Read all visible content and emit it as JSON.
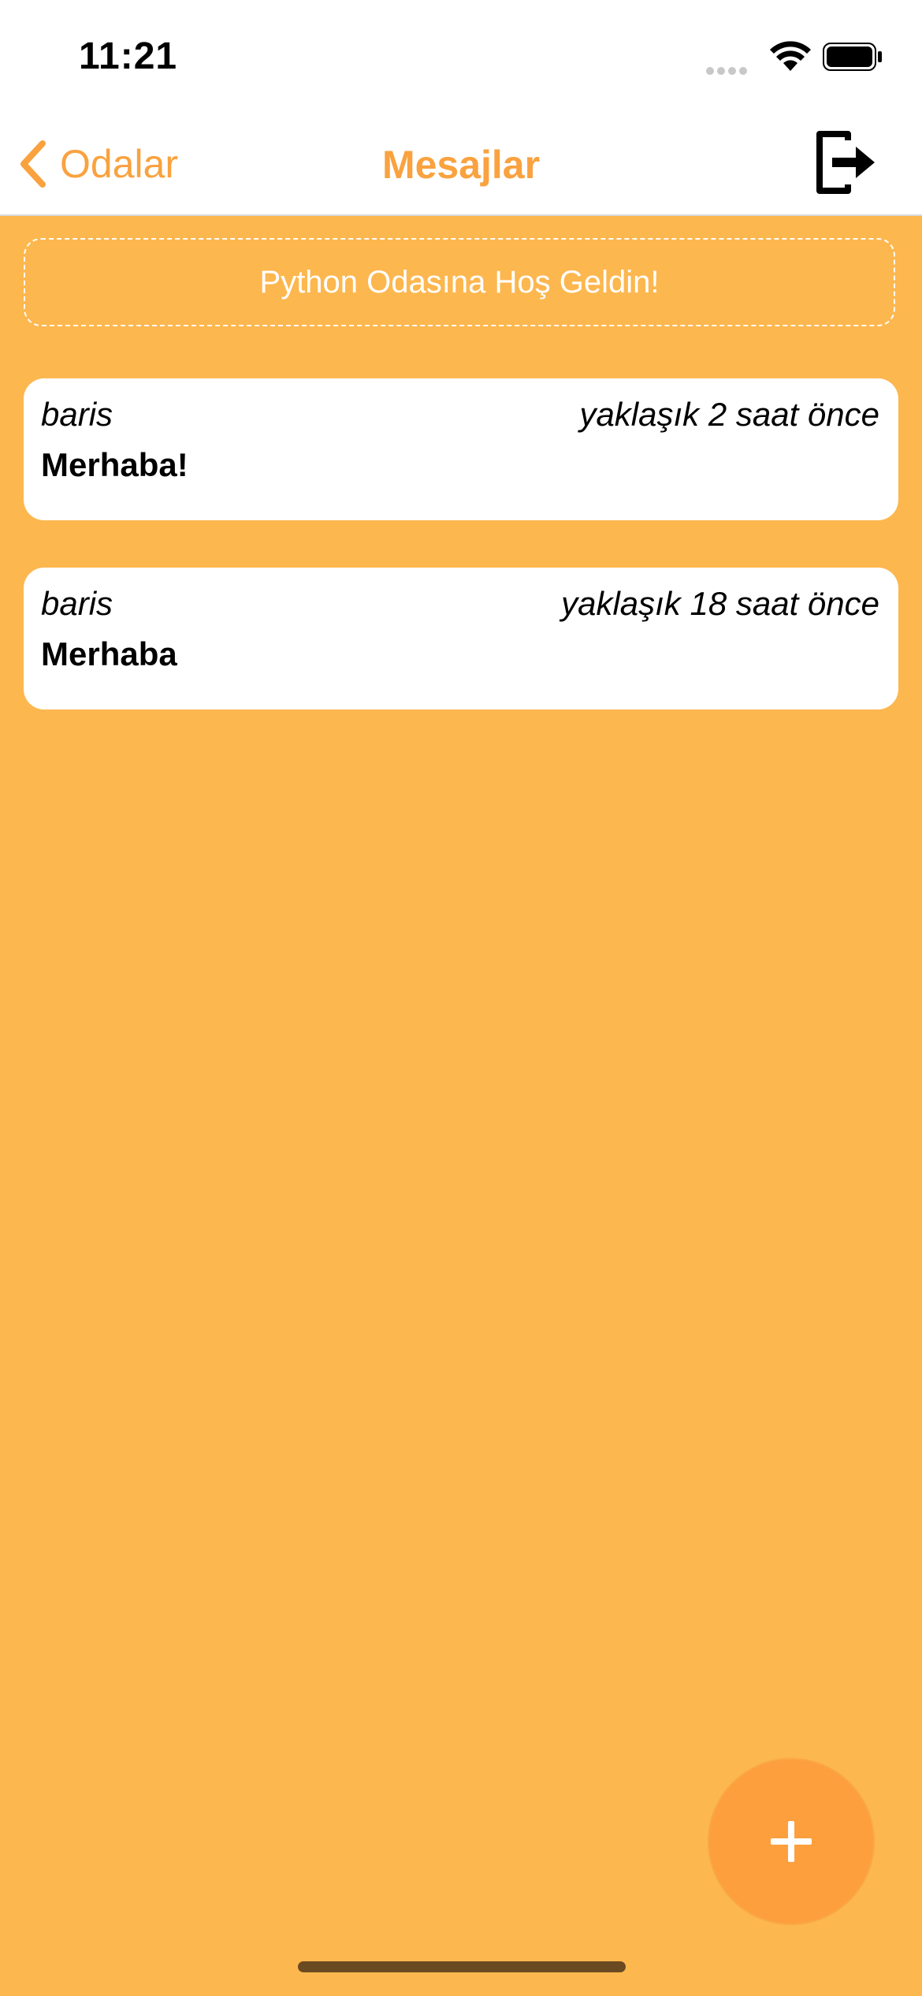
{
  "status_bar": {
    "time": "11:21"
  },
  "nav": {
    "back_label": "Odalar",
    "title": "Mesajlar",
    "icons": {
      "back": "chevron-left-icon",
      "logout": "logout-icon"
    }
  },
  "welcome_text": "Python Odasına Hoş Geldin!",
  "messages": [
    {
      "user": "baris",
      "time": "yaklaşık 2 saat önce",
      "text": "Merhaba!"
    },
    {
      "user": "baris",
      "time": "yaklaşık 18 saat önce",
      "text": "Merhaba"
    }
  ],
  "fab": {
    "icon": "plus-icon"
  },
  "colors": {
    "accent": "#F9A23F",
    "background": "#FDB74F",
    "fab": "#FD9F3D"
  }
}
